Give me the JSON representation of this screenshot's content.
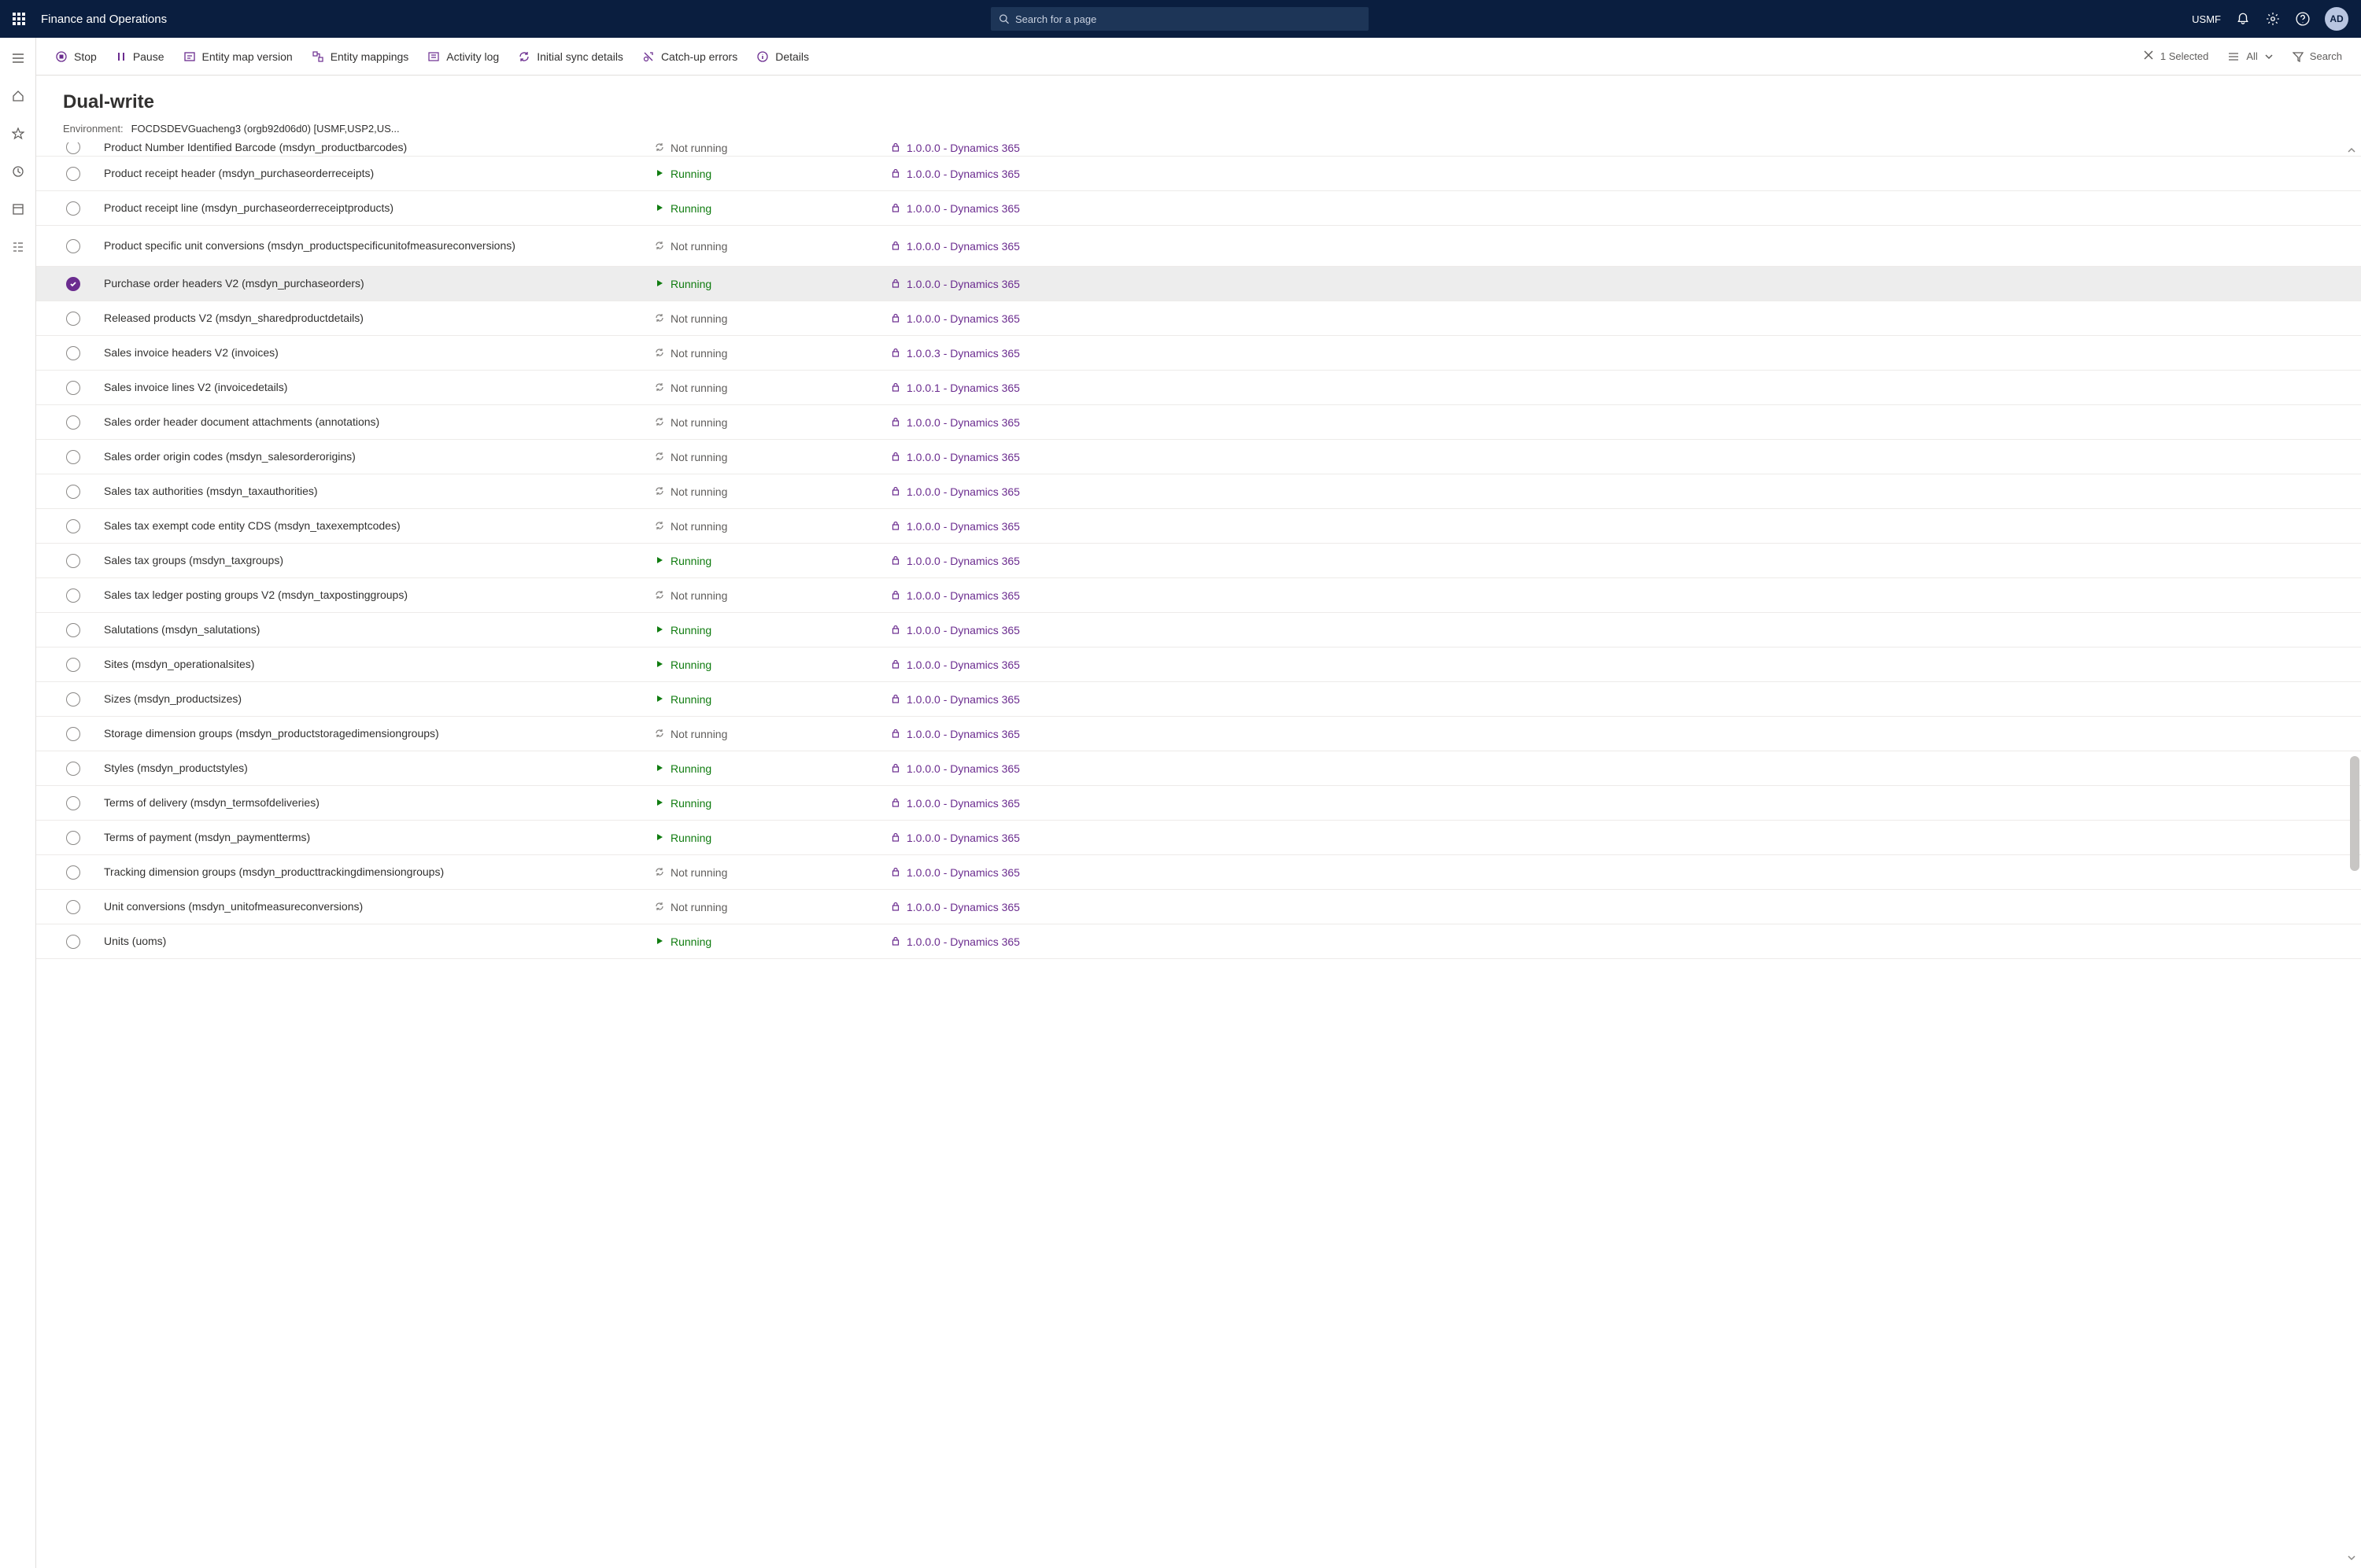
{
  "header": {
    "app_title": "Finance and Operations",
    "search_placeholder": "Search for a page",
    "company": "USMF",
    "avatar_initials": "AD"
  },
  "toolbar": {
    "stop": "Stop",
    "pause": "Pause",
    "entity_map_version": "Entity map version",
    "entity_mappings": "Entity mappings",
    "activity_log": "Activity log",
    "initial_sync_details": "Initial sync details",
    "catch_up_errors": "Catch-up errors",
    "details": "Details",
    "selected_count": "1 Selected",
    "filter_all": "All",
    "search_label": "Search"
  },
  "page": {
    "title": "Dual-write",
    "env_label": "Environment:",
    "env_value": "FOCDSDEVGuacheng3 (orgb92d06d0) [USMF,USP2,US..."
  },
  "status_labels": {
    "running": "Running",
    "not_running": "Not running"
  },
  "rows": [
    {
      "name": "Product Number Identified Barcode (msdyn_productbarcodes)",
      "status": "not_running",
      "version": "1.0.0.0 - Dynamics 365",
      "selected": false,
      "cutoff": true
    },
    {
      "name": "Product receipt header (msdyn_purchaseorderreceipts)",
      "status": "running",
      "version": "1.0.0.0 - Dynamics 365",
      "selected": false
    },
    {
      "name": "Product receipt line (msdyn_purchaseorderreceiptproducts)",
      "status": "running",
      "version": "1.0.0.0 - Dynamics 365",
      "selected": false
    },
    {
      "name": "Product specific unit conversions (msdyn_productspecificunitofmeasureconversions)",
      "status": "not_running",
      "version": "1.0.0.0 - Dynamics 365",
      "selected": false,
      "tall": true
    },
    {
      "name": "Purchase order headers V2 (msdyn_purchaseorders)",
      "status": "running",
      "version": "1.0.0.0 - Dynamics 365",
      "selected": true
    },
    {
      "name": "Released products V2 (msdyn_sharedproductdetails)",
      "status": "not_running",
      "version": "1.0.0.0 - Dynamics 365",
      "selected": false
    },
    {
      "name": "Sales invoice headers V2 (invoices)",
      "status": "not_running",
      "version": "1.0.0.3 - Dynamics 365",
      "selected": false
    },
    {
      "name": "Sales invoice lines V2 (invoicedetails)",
      "status": "not_running",
      "version": "1.0.0.1 - Dynamics 365",
      "selected": false
    },
    {
      "name": "Sales order header document attachments (annotations)",
      "status": "not_running",
      "version": "1.0.0.0 - Dynamics 365",
      "selected": false
    },
    {
      "name": "Sales order origin codes (msdyn_salesorderorigins)",
      "status": "not_running",
      "version": "1.0.0.0 - Dynamics 365",
      "selected": false
    },
    {
      "name": "Sales tax authorities (msdyn_taxauthorities)",
      "status": "not_running",
      "version": "1.0.0.0 - Dynamics 365",
      "selected": false
    },
    {
      "name": "Sales tax exempt code entity CDS (msdyn_taxexemptcodes)",
      "status": "not_running",
      "version": "1.0.0.0 - Dynamics 365",
      "selected": false
    },
    {
      "name": "Sales tax groups (msdyn_taxgroups)",
      "status": "running",
      "version": "1.0.0.0 - Dynamics 365",
      "selected": false
    },
    {
      "name": "Sales tax ledger posting groups V2 (msdyn_taxpostinggroups)",
      "status": "not_running",
      "version": "1.0.0.0 - Dynamics 365",
      "selected": false
    },
    {
      "name": "Salutations (msdyn_salutations)",
      "status": "running",
      "version": "1.0.0.0 - Dynamics 365",
      "selected": false
    },
    {
      "name": "Sites (msdyn_operationalsites)",
      "status": "running",
      "version": "1.0.0.0 - Dynamics 365",
      "selected": false
    },
    {
      "name": "Sizes (msdyn_productsizes)",
      "status": "running",
      "version": "1.0.0.0 - Dynamics 365",
      "selected": false
    },
    {
      "name": "Storage dimension groups (msdyn_productstoragedimensiongroups)",
      "status": "not_running",
      "version": "1.0.0.0 - Dynamics 365",
      "selected": false
    },
    {
      "name": "Styles (msdyn_productstyles)",
      "status": "running",
      "version": "1.0.0.0 - Dynamics 365",
      "selected": false
    },
    {
      "name": "Terms of delivery (msdyn_termsofdeliveries)",
      "status": "running",
      "version": "1.0.0.0 - Dynamics 365",
      "selected": false
    },
    {
      "name": "Terms of payment (msdyn_paymentterms)",
      "status": "running",
      "version": "1.0.0.0 - Dynamics 365",
      "selected": false
    },
    {
      "name": "Tracking dimension groups (msdyn_producttrackingdimensiongroups)",
      "status": "not_running",
      "version": "1.0.0.0 - Dynamics 365",
      "selected": false
    },
    {
      "name": "Unit conversions (msdyn_unitofmeasureconversions)",
      "status": "not_running",
      "version": "1.0.0.0 - Dynamics 365",
      "selected": false
    },
    {
      "name": "Units (uoms)",
      "status": "running",
      "version": "1.0.0.0 - Dynamics 365",
      "selected": false
    }
  ]
}
